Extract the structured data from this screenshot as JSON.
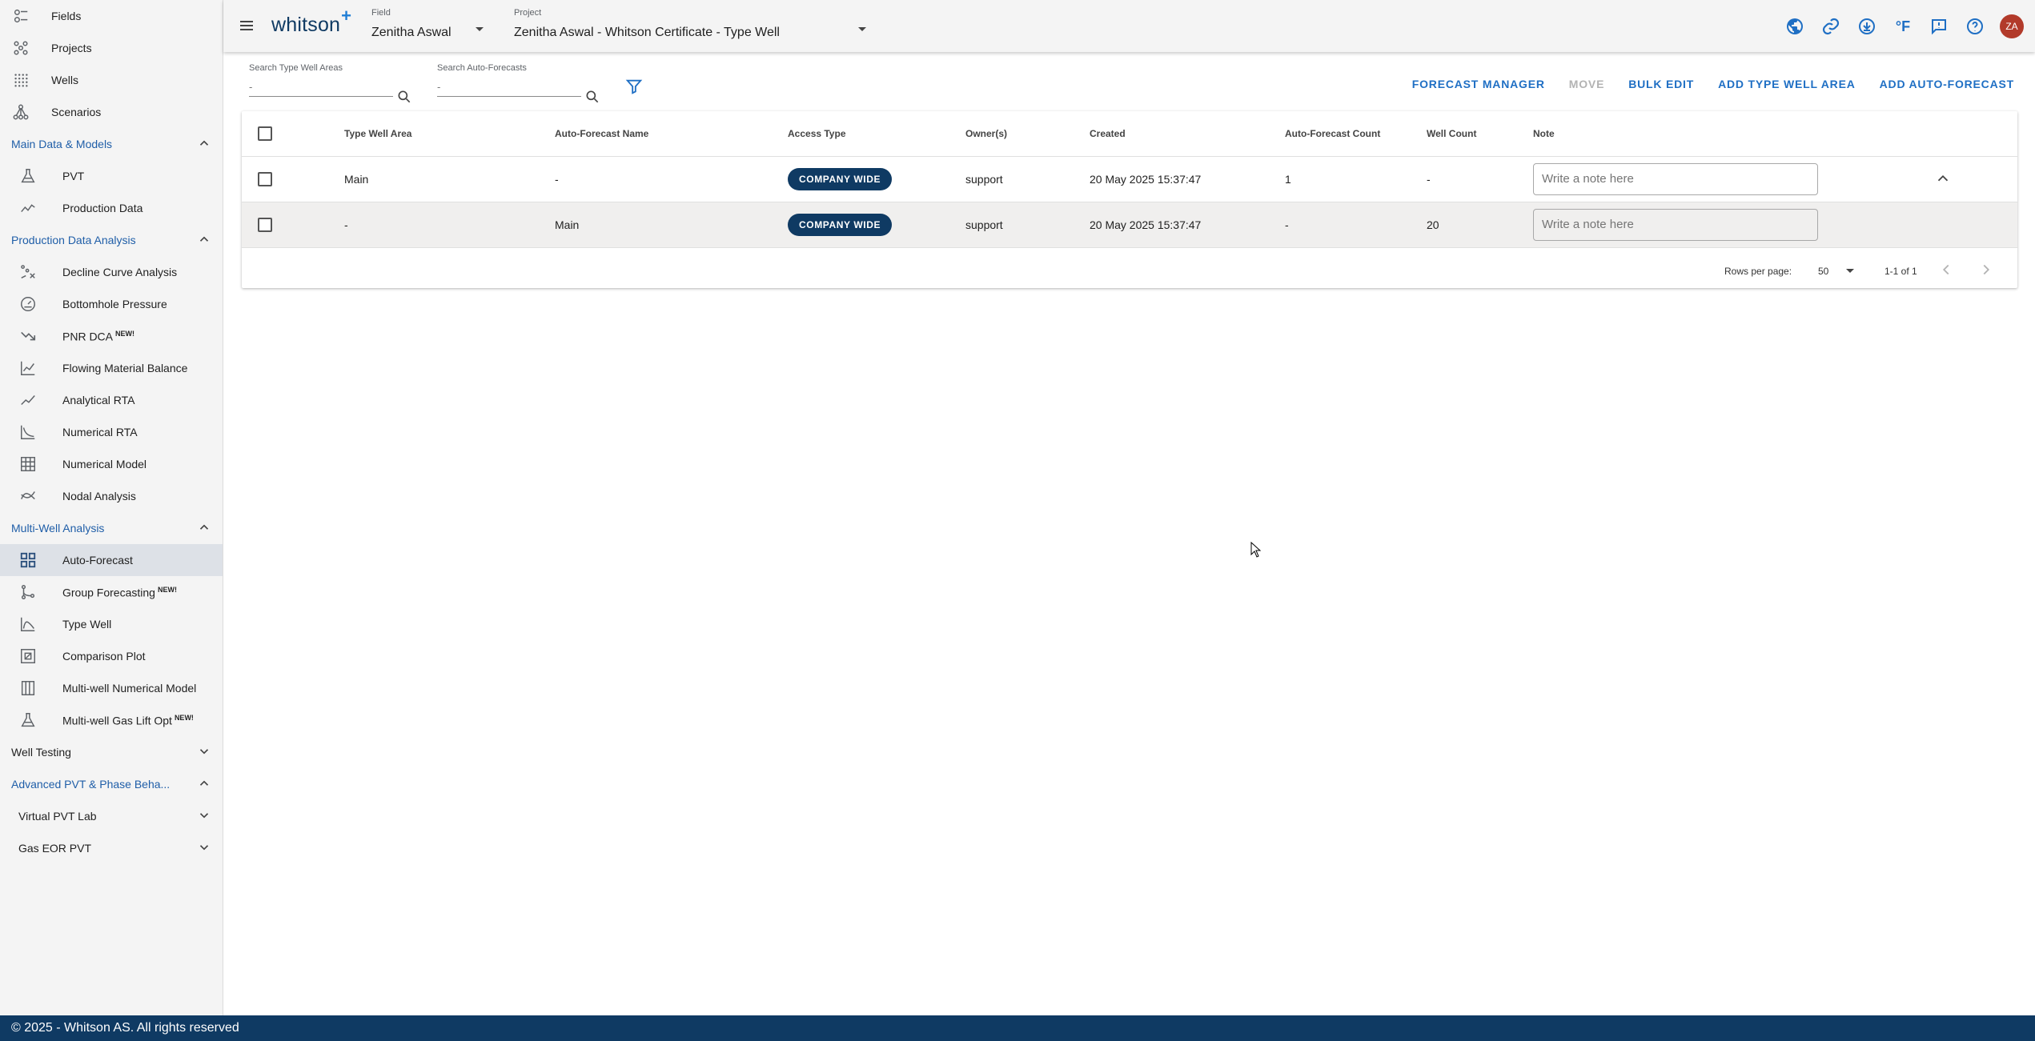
{
  "sidebar": {
    "top_items": [
      {
        "label": "Fields",
        "icon": "fields-icon"
      },
      {
        "label": "Projects",
        "icon": "projects-icon"
      },
      {
        "label": "Wells",
        "icon": "wells-icon"
      },
      {
        "label": "Scenarios",
        "icon": "scenarios-icon"
      }
    ],
    "sections": {
      "main_data": {
        "label": "Main Data & Models",
        "items": [
          "PVT",
          "Production Data"
        ]
      },
      "prod_analysis": {
        "label": "Production Data Analysis",
        "items": [
          "Decline Curve Analysis",
          "Bottomhole Pressure",
          "PNR DCA",
          "Flowing Material Balance",
          "Analytical RTA",
          "Numerical RTA",
          "Numerical Model",
          "Nodal Analysis"
        ]
      },
      "multi_well": {
        "label": "Multi-Well Analysis",
        "items": [
          "Auto-Forecast",
          "Group Forecasting",
          "Type Well",
          "Comparison Plot",
          "Multi-well Numerical Model",
          "Multi-well Gas Lift Opt"
        ]
      },
      "well_testing": {
        "label": "Well Testing"
      },
      "advanced_pvt": {
        "label": "Advanced PVT & Phase Beha..."
      },
      "virtual_pvt_lab": {
        "label": "Virtual PVT Lab"
      },
      "gas_eor_pvt": {
        "label": "Gas EOR PVT"
      }
    },
    "new_badge": "NEW!"
  },
  "topbar": {
    "logo": "whitson",
    "logo_plus": "+",
    "field_label": "Field",
    "field_value": "Zenitha Aswal",
    "project_label": "Project",
    "project_value": "Zenitha Aswal - Whitson Certificate - Type Well",
    "temp_unit": "°F",
    "avatar_initials": "ZA"
  },
  "toolbar": {
    "search_type_well_label": "Search Type Well Areas",
    "search_type_well_placeholder": "-",
    "search_autoforecast_label": "Search Auto-Forecasts",
    "search_autoforecast_placeholder": "-",
    "actions": {
      "forecast_manager": "FORECAST MANAGER",
      "move": "MOVE",
      "bulk_edit": "BULK EDIT",
      "add_type_well_area": "ADD TYPE WELL AREA",
      "add_auto_forecast": "ADD AUTO-FORECAST"
    }
  },
  "table": {
    "headers": {
      "type_well_area": "Type Well Area",
      "auto_forecast_name": "Auto-Forecast Name",
      "access_type": "Access Type",
      "owners": "Owner(s)",
      "created": "Created",
      "auto_forecast_count": "Auto-Forecast Count",
      "well_count": "Well Count",
      "note": "Note"
    },
    "rows": [
      {
        "type_well_area": "Main",
        "auto_forecast_name": "-",
        "access_type": "COMPANY WIDE",
        "owner": "support",
        "created": "20 May 2025 15:37:47",
        "auto_forecast_count": "1",
        "well_count": "-",
        "note_placeholder": "Write a note here"
      },
      {
        "type_well_area": "-",
        "auto_forecast_name": "Main",
        "access_type": "COMPANY WIDE",
        "owner": "support",
        "created": "20 May 2025 15:37:47",
        "auto_forecast_count": "-",
        "well_count": "20",
        "note_placeholder": "Write a note here"
      }
    ],
    "footer": {
      "rows_per_page_label": "Rows per page:",
      "rows_per_page_value": "50",
      "range": "1-1 of 1"
    }
  },
  "footer": {
    "text": "© 2025 - Whitson AS. All rights reserved"
  },
  "colors": {
    "brand_navy": "#0f3a63",
    "accent_blue": "#1f6fc4",
    "section_blue": "#1f5ea8",
    "avatar_red": "#b23a2a"
  }
}
